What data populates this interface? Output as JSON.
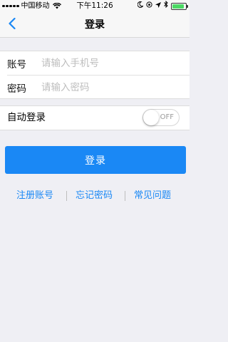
{
  "status_bar": {
    "carrier": "中国移动",
    "time": "下午11:26",
    "battery_level": 0.9,
    "battery_color": "#4cd964"
  },
  "nav": {
    "title": "登录",
    "back_icon": "chevron-left-icon"
  },
  "form": {
    "account_label": "账号",
    "account_placeholder": "请输入手机号",
    "account_value": "",
    "password_label": "密码",
    "password_placeholder": "请输入密码",
    "password_value": ""
  },
  "auto_login": {
    "label": "自动登录",
    "toggle_text": "OFF",
    "enabled": false
  },
  "login_button": {
    "label": "登录",
    "color": "#1a88f5"
  },
  "links": {
    "register": "注册账号",
    "forgot_password": "忘记密码",
    "faq": "常见问题",
    "color": "#1a88f5"
  }
}
